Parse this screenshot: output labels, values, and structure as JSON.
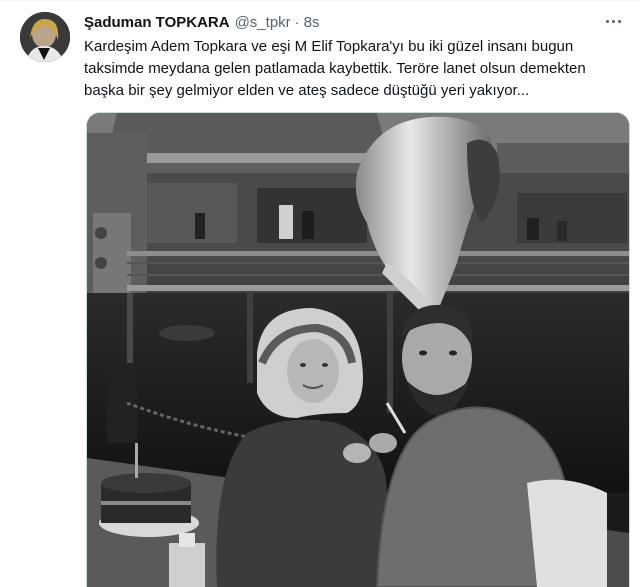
{
  "tweet": {
    "display_name": "Şaduman TOPKARA",
    "handle": "@s_tpkr",
    "separator": "·",
    "timestamp": "8s",
    "text": "Kardeşim Adem Topkara ve eşi M Elif Topkara'yı bu iki güzel insanı bugun\ntaksimde meydana gelen patlamada kaybettik. Teröre lanet olsun demekten\nbaşka bir şey gelmiyor elden ve ateş sadece düştüğü yeri yakıyor...",
    "more_icon": "more-horizontal-icon",
    "avatar_icon": "profile-avatar",
    "media": {
      "type": "photo",
      "tone": "black-and-white"
    }
  },
  "colors": {
    "text_primary": "#0f1419",
    "text_secondary": "#536471",
    "border": "#cfd9de"
  }
}
